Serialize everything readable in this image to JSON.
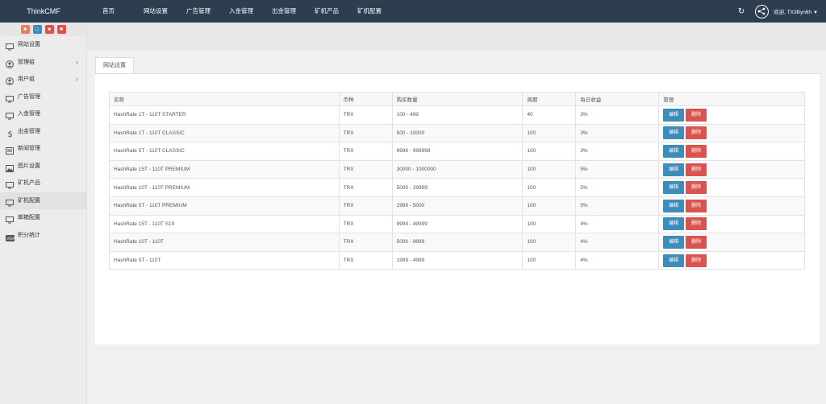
{
  "header": {
    "brand": "ThinkCMF",
    "nav": [
      "首页",
      "网站设置",
      "广告管理",
      "入金管理",
      "出金管理",
      "矿机产品",
      "矿机配置"
    ],
    "refresh_icon": "refresh-icon",
    "user_label": "欢迎, TX3Byn6h"
  },
  "sidebar": {
    "shortcut_icons": [
      "orange-shortcut-icon",
      "document-icon",
      "trash-icon",
      "settings-icon"
    ],
    "items": [
      {
        "label": "网站设置",
        "icon": "monitor-icon"
      },
      {
        "label": "管理组",
        "icon": "user-circle-icon",
        "arrow": true
      },
      {
        "label": "用户组",
        "icon": "user-circle-icon",
        "arrow": true
      },
      {
        "label": "广告管理",
        "icon": "monitor-icon"
      },
      {
        "label": "入金管理",
        "icon": "monitor-icon"
      },
      {
        "label": "出金管理",
        "icon": "dollar-icon"
      },
      {
        "label": "新闻管理",
        "icon": "newspaper-icon"
      },
      {
        "label": "图片设置",
        "icon": "image-icon"
      },
      {
        "label": "矿机产品",
        "icon": "monitor-icon"
      },
      {
        "label": "矿机配置",
        "icon": "monitor-icon",
        "active": true
      },
      {
        "label": "邮箱配置",
        "icon": "monitor-icon"
      },
      {
        "label": "积分统计",
        "icon": "visa-icon"
      }
    ]
  },
  "main": {
    "tab_label": "网站设置",
    "columns": [
      "名称",
      "币种",
      "购买数量",
      "周期",
      "每日收益",
      "管理"
    ],
    "edit_label": "编辑",
    "delete_label": "删除",
    "rows": [
      [
        "HashRate 1T - 110T STARTER",
        "TRX",
        "100 - 499",
        "40",
        "3%"
      ],
      [
        "HashRate 1T - 110T CLASSIC",
        "TRX",
        "500 - 10000",
        "100",
        "3%"
      ],
      [
        "HashRate 5T - 110T CLASSIC",
        "TRX",
        "9999 - 999999",
        "100",
        "3%"
      ],
      [
        "HashRate 15T - 110T PREMIUM",
        "TRX",
        "30000 - 1000000",
        "100",
        "5%"
      ],
      [
        "HashRate 10T - 110T PREMIUM",
        "TRX",
        "5000 - 29999",
        "100",
        "5%"
      ],
      [
        "HashRate 5T - 110T PREMIUM",
        "TRX",
        "2999 - 5000",
        "100",
        "5%"
      ],
      [
        "HashRate 15T - 110T S19",
        "TRX",
        "9999 - 49999",
        "100",
        "4%"
      ],
      [
        "HashRate 10T - 110T",
        "TRX",
        "5000 - 9999",
        "100",
        "4%"
      ],
      [
        "HashRate 5T - 110T",
        "TRX",
        "1999 - 4999",
        "100",
        "4%"
      ]
    ]
  },
  "colors": {
    "topbar": "#2c3e50",
    "edit_button": "#3c8dbc",
    "delete_button": "#d9534f"
  }
}
